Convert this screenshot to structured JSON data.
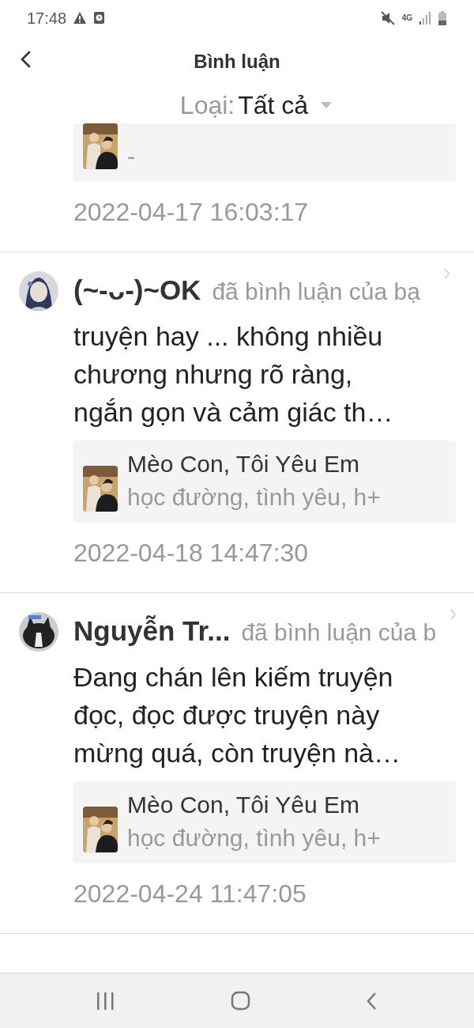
{
  "status_bar": {
    "time": "17:48",
    "network": "4G"
  },
  "header": {
    "title": "Bình luận"
  },
  "filter": {
    "label": "Loại:",
    "value": "Tất cả"
  },
  "comments": [
    {
      "kind": "cut",
      "story": {
        "tags": "-"
      },
      "date": "2022-04-17 16:03:17"
    },
    {
      "kind": "full",
      "user": "(~-ᴗ-)~OK",
      "action": "đã bình luận của bạ",
      "text": "truyện hay ... không nhiều chương nhưng rõ ràng, ngắn gọn và cảm giác th…",
      "story": {
        "title": "Mèo Con, Tôi Yêu Em",
        "tags": "học đường, tình yêu, h+"
      },
      "date": "2022-04-18 14:47:30"
    },
    {
      "kind": "full",
      "user": "Nguyễn Tr...",
      "action": "đã bình luận của b",
      "text": "Đang chán lên kiếm truyện đọc, đọc được truyện này mừng quá, còn truyện nà…",
      "story": {
        "title": "Mèo Con, Tôi Yêu Em",
        "tags": "học đường, tình yêu, h+"
      },
      "date": "2022-04-24 11:47:05"
    }
  ]
}
